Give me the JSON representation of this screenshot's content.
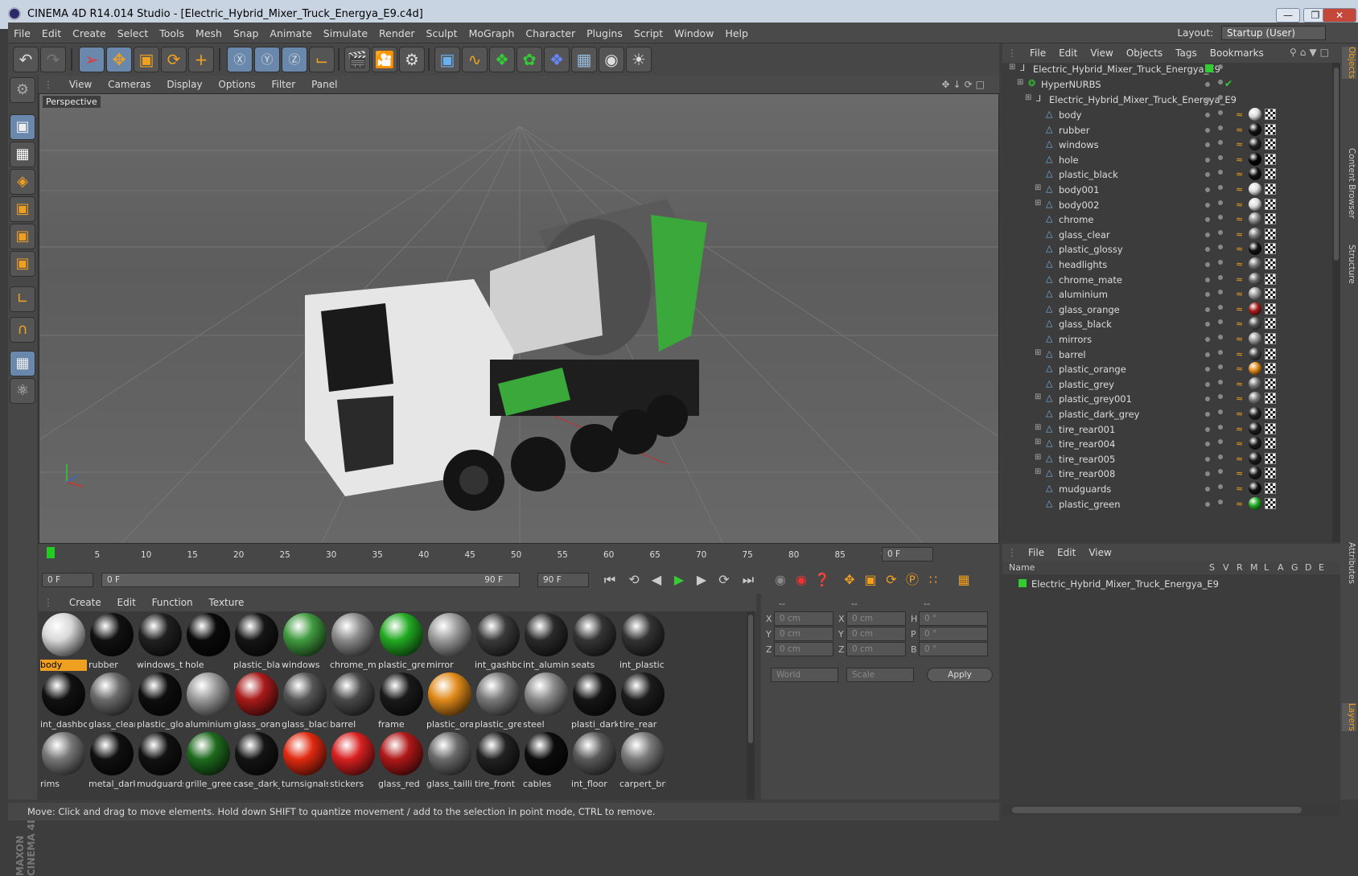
{
  "window": {
    "title": "CINEMA 4D R14.014 Studio - [Electric_Hybrid_Mixer_Truck_Energya_E9.c4d]",
    "minimize": "—",
    "maximize": "❐",
    "close": "✕"
  },
  "menu": [
    "File",
    "Edit",
    "Create",
    "Select",
    "Tools",
    "Mesh",
    "Snap",
    "Animate",
    "Simulate",
    "Render",
    "Sculpt",
    "MoGraph",
    "Character",
    "Plugins",
    "Script",
    "Window",
    "Help"
  ],
  "layout": {
    "label": "Layout:",
    "value": "Startup (User)"
  },
  "viewport": {
    "menu": [
      "View",
      "Cameras",
      "Display",
      "Options",
      "Filter",
      "Panel"
    ],
    "label": "Perspective"
  },
  "timeline": {
    "ticks": [
      "0",
      "5",
      "10",
      "15",
      "20",
      "25",
      "30",
      "35",
      "40",
      "45",
      "50",
      "55",
      "60",
      "65",
      "70",
      "75",
      "80",
      "85",
      "90"
    ],
    "current": "0 F",
    "start": "0 F",
    "range_start": "0 F",
    "range_end": "90 F",
    "end": "90 F"
  },
  "materials": {
    "menu": [
      "Create",
      "Edit",
      "Function",
      "Texture"
    ],
    "items": [
      {
        "name": "body",
        "color": "#d8d8d8"
      },
      {
        "name": "rubber",
        "color": "#111"
      },
      {
        "name": "windows_t",
        "color": "#202020"
      },
      {
        "name": "hole",
        "color": "#0a0a0a"
      },
      {
        "name": "plastic_bla",
        "color": "#151515"
      },
      {
        "name": "windows",
        "color": "#3f9a3f"
      },
      {
        "name": "chrome_ma",
        "color": "#8a8a8a"
      },
      {
        "name": "plastic_gre",
        "color": "#22aa22"
      },
      {
        "name": "mirror",
        "color": "#9a9a9a"
      },
      {
        "name": "int_gashbc",
        "color": "#3a3a3a"
      },
      {
        "name": "int_alumini",
        "color": "#2a2a2a"
      },
      {
        "name": "seats",
        "color": "#353535"
      },
      {
        "name": "int_plastic",
        "color": "#333"
      },
      {
        "name": "int_dashbc",
        "color": "#111"
      },
      {
        "name": "glass_clear",
        "color": "#6a6a6a"
      },
      {
        "name": "plastic_glo",
        "color": "#0e0e0e"
      },
      {
        "name": "aluminium",
        "color": "#9a9a9a"
      },
      {
        "name": "glass_oran",
        "color": "#a81a1a"
      },
      {
        "name": "glass_black",
        "color": "#555"
      },
      {
        "name": "barrel",
        "color": "#4a4a4a"
      },
      {
        "name": "frame",
        "color": "#1a1a1a"
      },
      {
        "name": "plastic_ora",
        "color": "#e08a1a"
      },
      {
        "name": "plastic_gre",
        "color": "#7a7a7a"
      },
      {
        "name": "steel",
        "color": "#8a8a8a"
      },
      {
        "name": "plasti_dark",
        "color": "#161616"
      },
      {
        "name": "tire_rear",
        "color": "#1c1c1c"
      },
      {
        "name": "rims",
        "color": "#777"
      },
      {
        "name": "metal_dark",
        "color": "#101010"
      },
      {
        "name": "mudguards",
        "color": "#111"
      },
      {
        "name": "grille_greei",
        "color": "#1e6a1e"
      },
      {
        "name": "case_dark_",
        "color": "#141414"
      },
      {
        "name": "turnsignals",
        "color": "#e02a10"
      },
      {
        "name": "stickers",
        "color": "#d82020"
      },
      {
        "name": "glass_red",
        "color": "#b01818"
      },
      {
        "name": "glass_tailli",
        "color": "#6a6a6a"
      },
      {
        "name": "tire_front",
        "color": "#222"
      },
      {
        "name": "cables",
        "color": "#0c0c0c"
      },
      {
        "name": "int_floor",
        "color": "#5a5a5a"
      },
      {
        "name": "carpert_bri",
        "color": "#7a7a7a"
      }
    ]
  },
  "coords": {
    "head": [
      "--",
      "--",
      "--"
    ],
    "rows": [
      [
        "X",
        "0 cm",
        "X",
        "0 cm",
        "H",
        "0 °"
      ],
      [
        "Y",
        "0 cm",
        "Y",
        "0 cm",
        "P",
        "0 °"
      ],
      [
        "Z",
        "0 cm",
        "Z",
        "0 cm",
        "B",
        "0 °"
      ]
    ],
    "world": "World",
    "scale": "Scale",
    "apply": "Apply"
  },
  "objects": {
    "menu": [
      "File",
      "Edit",
      "View",
      "Objects",
      "Tags",
      "Bookmarks"
    ],
    "root": "Electric_Hybrid_Mixer_Truck_Energya_E9",
    "hypernurbs": "HyperNURBS",
    "group": "Electric_Hybrid_Mixer_Truck_Energya_E9",
    "children": [
      {
        "name": "body",
        "mat": "#ddd",
        "expand": ""
      },
      {
        "name": "rubber",
        "mat": "#111",
        "expand": ""
      },
      {
        "name": "windows",
        "mat": "#222",
        "expand": ""
      },
      {
        "name": "hole",
        "mat": "#000",
        "expand": ""
      },
      {
        "name": "plastic_black",
        "mat": "#111",
        "expand": ""
      },
      {
        "name": "body001",
        "mat": "#ddd",
        "expand": "+"
      },
      {
        "name": "body002",
        "mat": "#ddd",
        "expand": "+"
      },
      {
        "name": "chrome",
        "mat": "#888",
        "expand": ""
      },
      {
        "name": "glass_clear",
        "mat": "#777",
        "expand": ""
      },
      {
        "name": "plastic_glossy",
        "mat": "#111",
        "expand": ""
      },
      {
        "name": "headlights",
        "mat": "#777",
        "expand": ""
      },
      {
        "name": "chrome_mate",
        "mat": "#666",
        "expand": ""
      },
      {
        "name": "aluminium",
        "mat": "#999",
        "expand": ""
      },
      {
        "name": "glass_orange",
        "mat": "#a81a1a",
        "expand": ""
      },
      {
        "name": "glass_black",
        "mat": "#555",
        "expand": ""
      },
      {
        "name": "mirrors",
        "mat": "#999",
        "expand": ""
      },
      {
        "name": "barrel",
        "mat": "#444",
        "expand": "+"
      },
      {
        "name": "plastic_orange",
        "mat": "#e08a1a",
        "expand": ""
      },
      {
        "name": "plastic_grey",
        "mat": "#777",
        "expand": ""
      },
      {
        "name": "plastic_grey001",
        "mat": "#777",
        "expand": "+"
      },
      {
        "name": "plastic_dark_grey",
        "mat": "#222",
        "expand": ""
      },
      {
        "name": "tire_rear001",
        "mat": "#1c1c1c",
        "expand": "+"
      },
      {
        "name": "tire_rear004",
        "mat": "#1c1c1c",
        "expand": "+"
      },
      {
        "name": "tire_rear005",
        "mat": "#1c1c1c",
        "expand": "+"
      },
      {
        "name": "tire_rear008",
        "mat": "#1c1c1c",
        "expand": "+"
      },
      {
        "name": "mudguards",
        "mat": "#111",
        "expand": ""
      },
      {
        "name": "plastic_green",
        "mat": "#22aa22",
        "expand": ""
      }
    ]
  },
  "layers": {
    "menu": [
      "File",
      "Edit",
      "View"
    ],
    "columns": [
      "Name",
      "S",
      "V",
      "R",
      "M",
      "L",
      "A",
      "G",
      "D",
      "E"
    ],
    "rows": [
      "Electric_Hybrid_Mixer_Truck_Energya_E9"
    ]
  },
  "right_tabs": [
    "Objects",
    "Content Browser",
    "Structure",
    "Attributes",
    "Layers"
  ],
  "branding": "MAXON CINEMA 4D",
  "status": "Move: Click and drag to move elements. Hold down SHIFT to quantize movement / add to the selection in point mode, CTRL to remove."
}
